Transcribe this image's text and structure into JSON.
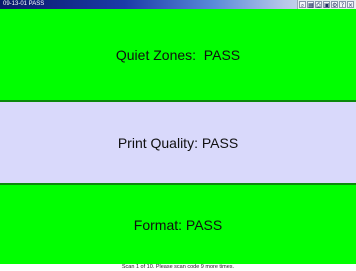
{
  "window": {
    "title": "09-13-01 PASS"
  },
  "toolbar": {
    "icons": [
      "zoom-icon",
      "grid-icon",
      "print-icon",
      "save-icon",
      "settings-icon",
      "help-icon",
      "close-icon"
    ],
    "glyphs": [
      "⌕",
      "▦",
      "⎙",
      "▣",
      "⚙",
      "?",
      "×"
    ]
  },
  "results": [
    {
      "label": "Quiet Zones:  PASS",
      "color": "#00ff00"
    },
    {
      "label": "Print Quality: PASS",
      "color": "#d9d9fb"
    },
    {
      "label": "Format: PASS",
      "color": "#00ff00"
    }
  ],
  "status": {
    "message": "Scan 1 of 10. Please scan code 9 more times."
  }
}
